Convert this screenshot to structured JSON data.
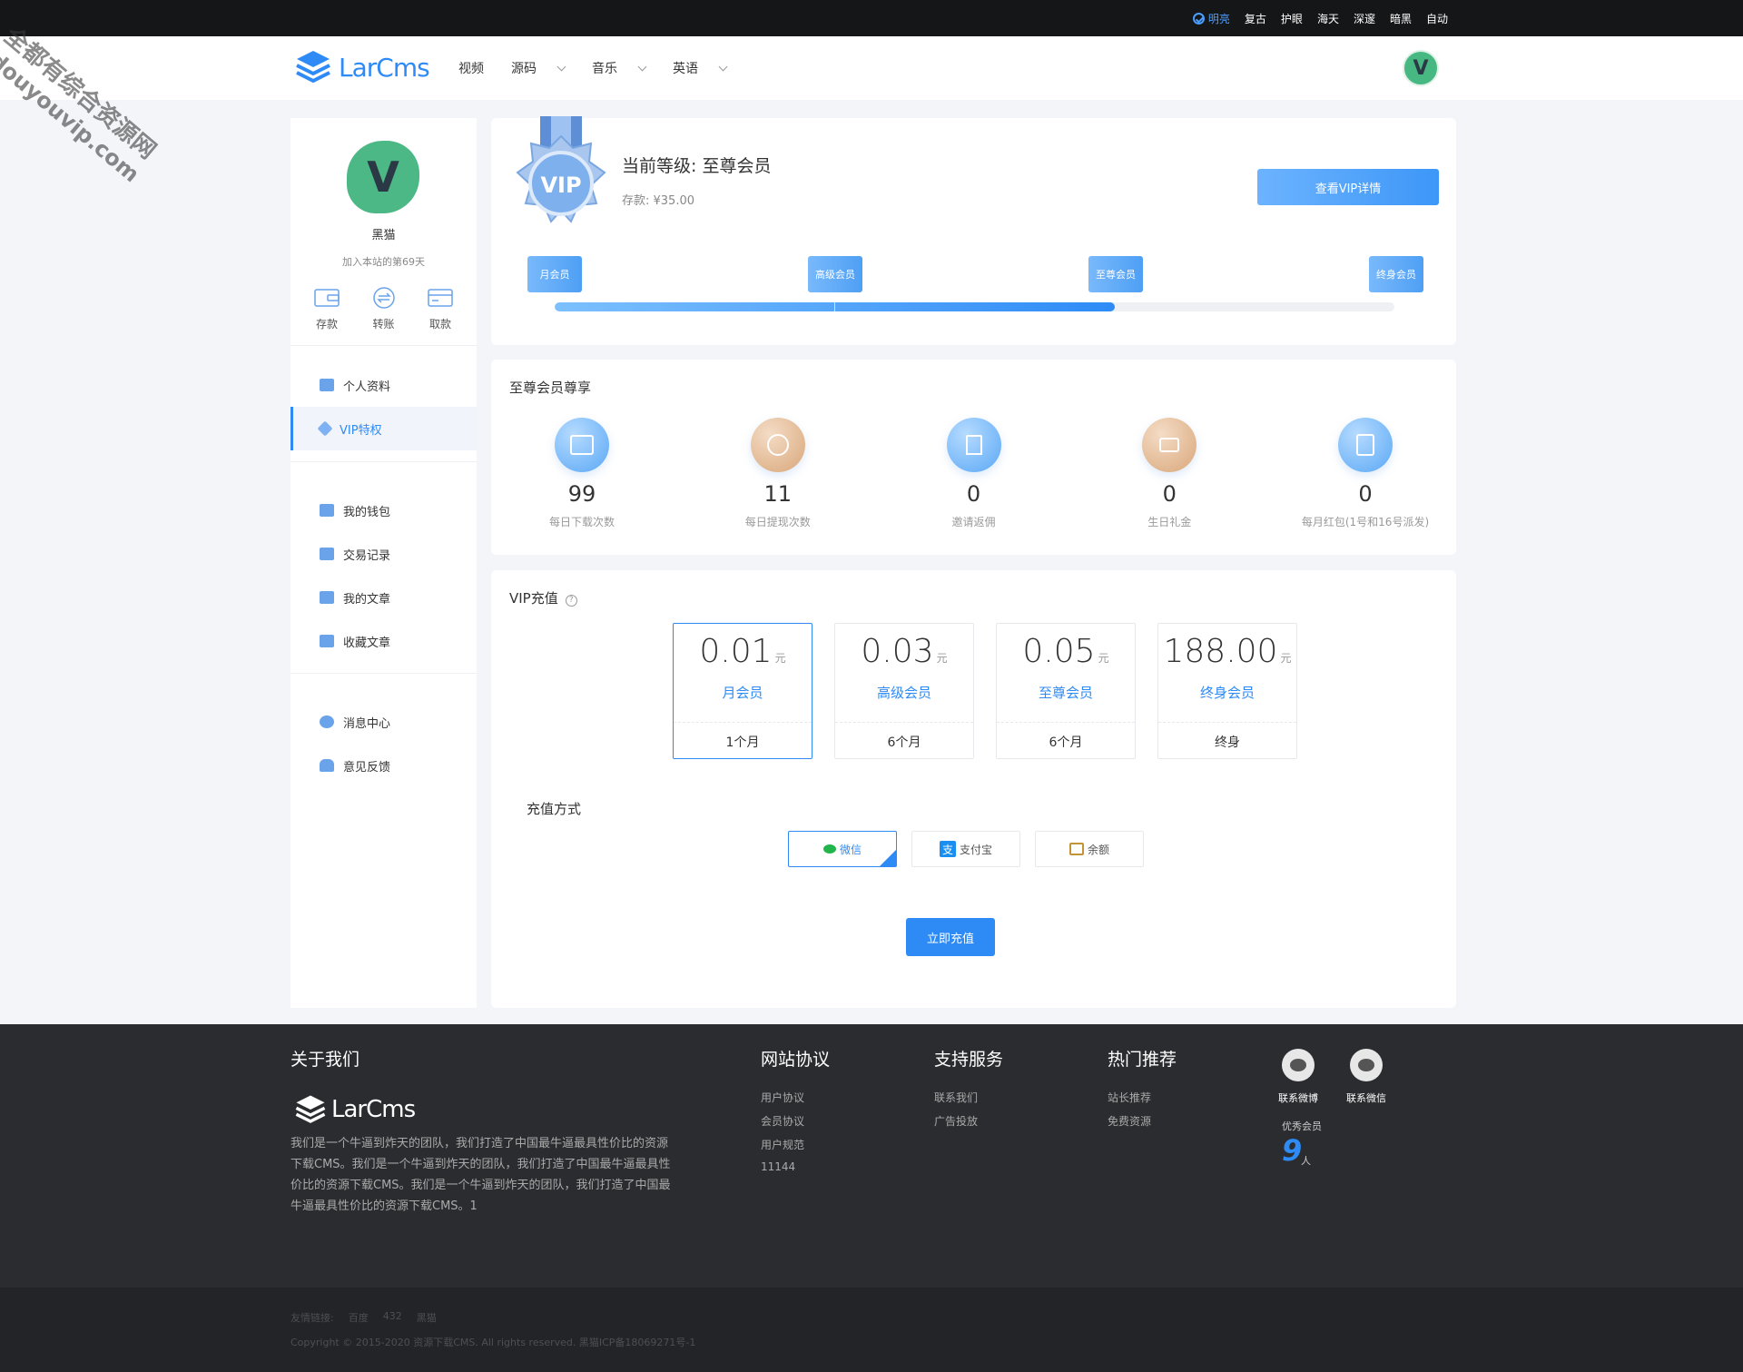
{
  "watermark": {
    "line1": "全都有综合资源网",
    "line2": "douyouvip.com"
  },
  "topbar": {
    "themes": [
      {
        "label": "明亮",
        "active": true
      },
      {
        "label": "复古",
        "active": false
      },
      {
        "label": "护眼",
        "active": false
      },
      {
        "label": "海天",
        "active": false
      },
      {
        "label": "深邃",
        "active": false
      },
      {
        "label": "暗黑",
        "active": false
      },
      {
        "label": "自动",
        "active": false
      }
    ]
  },
  "header": {
    "logo_text": "LarCms",
    "nav": [
      {
        "label": "视频",
        "has_dropdown": false
      },
      {
        "label": "源码",
        "has_dropdown": true
      },
      {
        "label": "音乐",
        "has_dropdown": true
      },
      {
        "label": "英语",
        "has_dropdown": true
      }
    ],
    "avatar_letter": "V"
  },
  "sidebar": {
    "avatar_letter": "V",
    "username": "黑猫",
    "joined": "加入本站的第69天",
    "quick_actions": [
      {
        "label": "存款",
        "icon": "wallet-icon"
      },
      {
        "label": "转账",
        "icon": "transfer-icon"
      },
      {
        "label": "取款",
        "icon": "card-icon"
      }
    ],
    "groups": [
      [
        {
          "label": "个人资料",
          "icon": "profile-card-icon",
          "active": false
        },
        {
          "label": "VIP特权",
          "icon": "diamond-icon",
          "active": true
        }
      ],
      [
        {
          "label": "我的钱包",
          "icon": "purse-icon",
          "active": false
        },
        {
          "label": "交易记录",
          "icon": "record-icon",
          "active": false
        },
        {
          "label": "我的文章",
          "icon": "article-icon",
          "active": false
        },
        {
          "label": "收藏文章",
          "icon": "bookmark-icon",
          "active": false
        }
      ],
      [
        {
          "label": "消息中心",
          "icon": "message-icon",
          "active": false
        },
        {
          "label": "意见反馈",
          "icon": "bell-icon",
          "active": false
        }
      ]
    ]
  },
  "level_card": {
    "title": "当前等级: 至尊会员",
    "deposit": "存款: ¥35.00",
    "detail_button": "查看VIP详情",
    "medal_text": "VIP",
    "levels": [
      "月会员",
      "高级会员",
      "至尊会员",
      "终身会员"
    ],
    "progress": 0.667
  },
  "privileges": {
    "title": "至尊会员尊享",
    "items": [
      {
        "value": "99",
        "label": "每日下载次数",
        "tone": "blue",
        "icon": "download-card-icon"
      },
      {
        "value": "11",
        "label": "每日提现次数",
        "tone": "tan",
        "icon": "withdraw-icon"
      },
      {
        "value": "0",
        "label": "邀请返佣",
        "tone": "blue",
        "icon": "invite-icon"
      },
      {
        "value": "0",
        "label": "生日礼金",
        "tone": "tan",
        "icon": "cake-icon"
      },
      {
        "value": "0",
        "label": "每月红包(1号和16号派发)",
        "tone": "blue",
        "icon": "red-packet-icon"
      }
    ]
  },
  "recharge": {
    "title": "VIP充值",
    "plans": [
      {
        "price": "0.01",
        "unit": "元",
        "name": "月会员",
        "duration": "1个月",
        "active": true
      },
      {
        "price": "0.03",
        "unit": "元",
        "name": "高级会员",
        "duration": "6个月",
        "active": false
      },
      {
        "price": "0.05",
        "unit": "元",
        "name": "至尊会员",
        "duration": "6个月",
        "active": false
      },
      {
        "price": "188.00",
        "unit": "元",
        "name": "终身会员",
        "duration": "终身",
        "active": false
      }
    ],
    "pay_title": "充值方式",
    "pay_methods": [
      {
        "label": "微信",
        "icon": "wechat-pay-icon",
        "active": true
      },
      {
        "label": "支付宝",
        "icon": "alipay-icon",
        "active": false
      },
      {
        "label": "余额",
        "icon": "balance-wallet-icon",
        "active": false
      }
    ],
    "submit": "立即充值"
  },
  "footer": {
    "about_title": "关于我们",
    "logo_text": "LarCms",
    "about_desc": "我们是一个牛逼到炸天的团队，我们打造了中国最牛逼最具性价比的资源下载CMS。我们是一个牛逼到炸天的团队，我们打造了中国最牛逼最具性价比的资源下载CMS。我们是一个牛逼到炸天的团队，我们打造了中国最牛逼最具性价比的资源下载CMS。1",
    "columns": [
      {
        "title": "网站协议",
        "links": [
          "用户协议",
          "会员协议",
          "用户规范",
          "11144"
        ]
      },
      {
        "title": "支持服务",
        "links": [
          "联系我们",
          "广告投放"
        ]
      },
      {
        "title": "热门推荐",
        "links": [
          "站长推荐",
          "免费资源"
        ]
      }
    ],
    "social": [
      {
        "label": "联系微博",
        "icon": "weibo-icon"
      },
      {
        "label": "联系微信",
        "icon": "wechat-icon"
      }
    ],
    "vip_label": "优秀会员",
    "vip_count": "9",
    "vip_unit": "人"
  },
  "bottom": {
    "friend_label": "友情链接:",
    "friends": [
      "百度",
      "432",
      "黑猫"
    ],
    "copyright": "Copyright © 2015-2020 资源下载CMS. All rights reserved. 黑猫ICP备18069271号-1"
  }
}
